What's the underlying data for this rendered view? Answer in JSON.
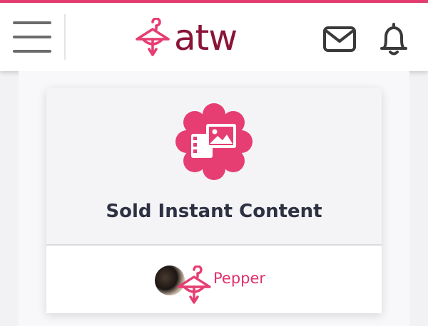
{
  "header": {
    "brand_name": "atw",
    "menu_icon": "hamburger-menu-icon",
    "logo_icon": "hanger-logo-icon",
    "messages_icon": "envelope-icon",
    "notifications_icon": "bell-icon"
  },
  "card": {
    "badge_icon": "media-gallery-icon",
    "title": "Sold Instant Content",
    "seller": {
      "name": "Pepper",
      "badge_icon": "hanger-icon"
    }
  },
  "colors": {
    "accent": "#e63d72",
    "brand_text": "#8a1538",
    "title_text": "#2d3142",
    "icon_gray": "#3a3a3a"
  }
}
